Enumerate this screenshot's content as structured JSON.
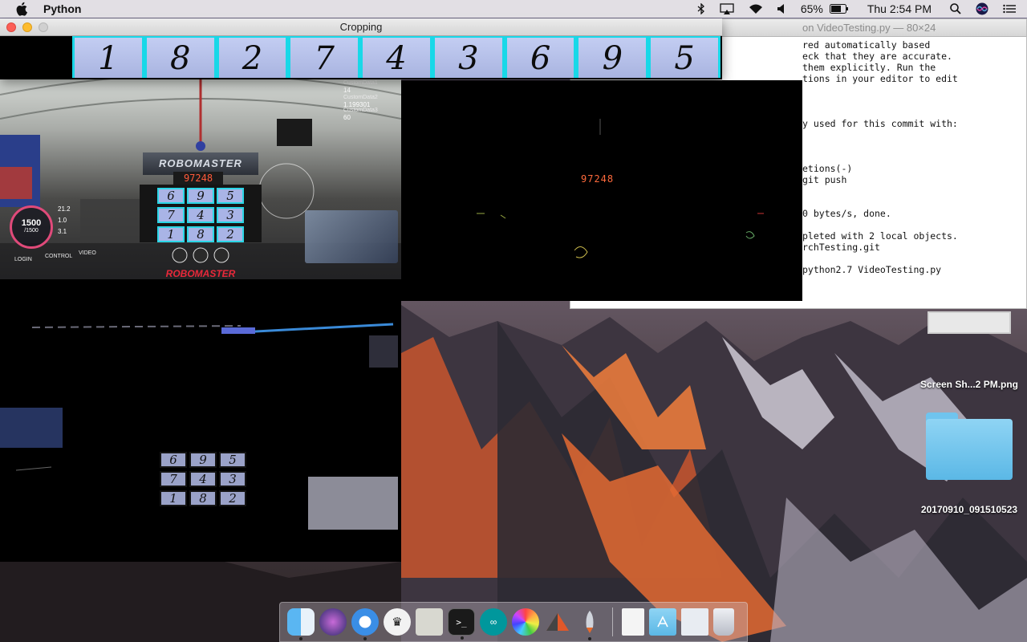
{
  "menubar": {
    "app_name": "Python",
    "battery": "65%",
    "clock": "Thu 2:54 PM",
    "icons": [
      "apple-icon",
      "bluetooth-icon",
      "airplay-icon",
      "wifi-icon",
      "volume-icon",
      "battery-icon",
      "spotlight-icon",
      "siri-icon",
      "notification-center-icon"
    ]
  },
  "crop_window": {
    "title": "Cropping",
    "digits": [
      "1",
      "8",
      "2",
      "7",
      "4",
      "3",
      "6",
      "9",
      "5"
    ]
  },
  "terminal": {
    "title": "on VideoTesting.py — 80×24",
    "lines": [
      "red automatically based",
      "eck that they are accurate.",
      "them explicitly. Run the",
      "tions in your editor to edit",
      "",
      "",
      "",
      "y used for this commit with:",
      "",
      "",
      "",
      "etions(-)",
      "git push",
      "",
      "",
      "0 bytes/s, done.",
      "",
      "pleted with 2 local objects.",
      "rchTesting.git",
      "",
      "python2.7 VideoTesting.py"
    ]
  },
  "cv_window": {
    "readout": "97248"
  },
  "game": {
    "banner": "ROBOMASTER",
    "score": "97248",
    "digit_grid": [
      "6",
      "9",
      "5",
      "7",
      "4",
      "3",
      "1",
      "8",
      "2"
    ],
    "custom_labels": [
      "CustomData1",
      "CustomData2",
      "CustomData3"
    ],
    "custom_values": [
      "14",
      "1.199301",
      "60"
    ],
    "gauge_value": "1500",
    "gauge_sub": "/1500",
    "stats": [
      "21.2",
      "1.0",
      "3.1"
    ],
    "footer_brand": "ROBOMASTER",
    "bottom_menu": [
      "LOGIN",
      "CONTROL",
      "VIDEO"
    ]
  },
  "masked_frame": {
    "digit_grid": [
      "6",
      "9",
      "5",
      "7",
      "4",
      "3",
      "1",
      "8",
      "2"
    ]
  },
  "desktop": {
    "screenshot_label": "Screen Sh...2 PM.png",
    "folder_label": "20170910_091510523"
  },
  "dock": {
    "items": [
      {
        "name": "finder",
        "running": true
      },
      {
        "name": "siri",
        "running": false
      },
      {
        "name": "safari",
        "running": true
      },
      {
        "name": "crown-app",
        "running": false
      },
      {
        "name": "gameboy-app",
        "running": false
      },
      {
        "name": "terminal",
        "running": true
      },
      {
        "name": "arduino",
        "running": false
      },
      {
        "name": "photos",
        "running": false
      },
      {
        "name": "sketchup",
        "running": false
      },
      {
        "name": "rocket-app",
        "running": true
      },
      {
        "name": "document",
        "running": false
      },
      {
        "name": "applications-folder",
        "running": false
      },
      {
        "name": "downloads-stack",
        "running": false
      },
      {
        "name": "trash",
        "running": false
      }
    ]
  },
  "colors": {
    "accent_cyan": "#18d8e8",
    "score_orange": "#ff5a3a",
    "robomaster_red": "#e8283a"
  }
}
